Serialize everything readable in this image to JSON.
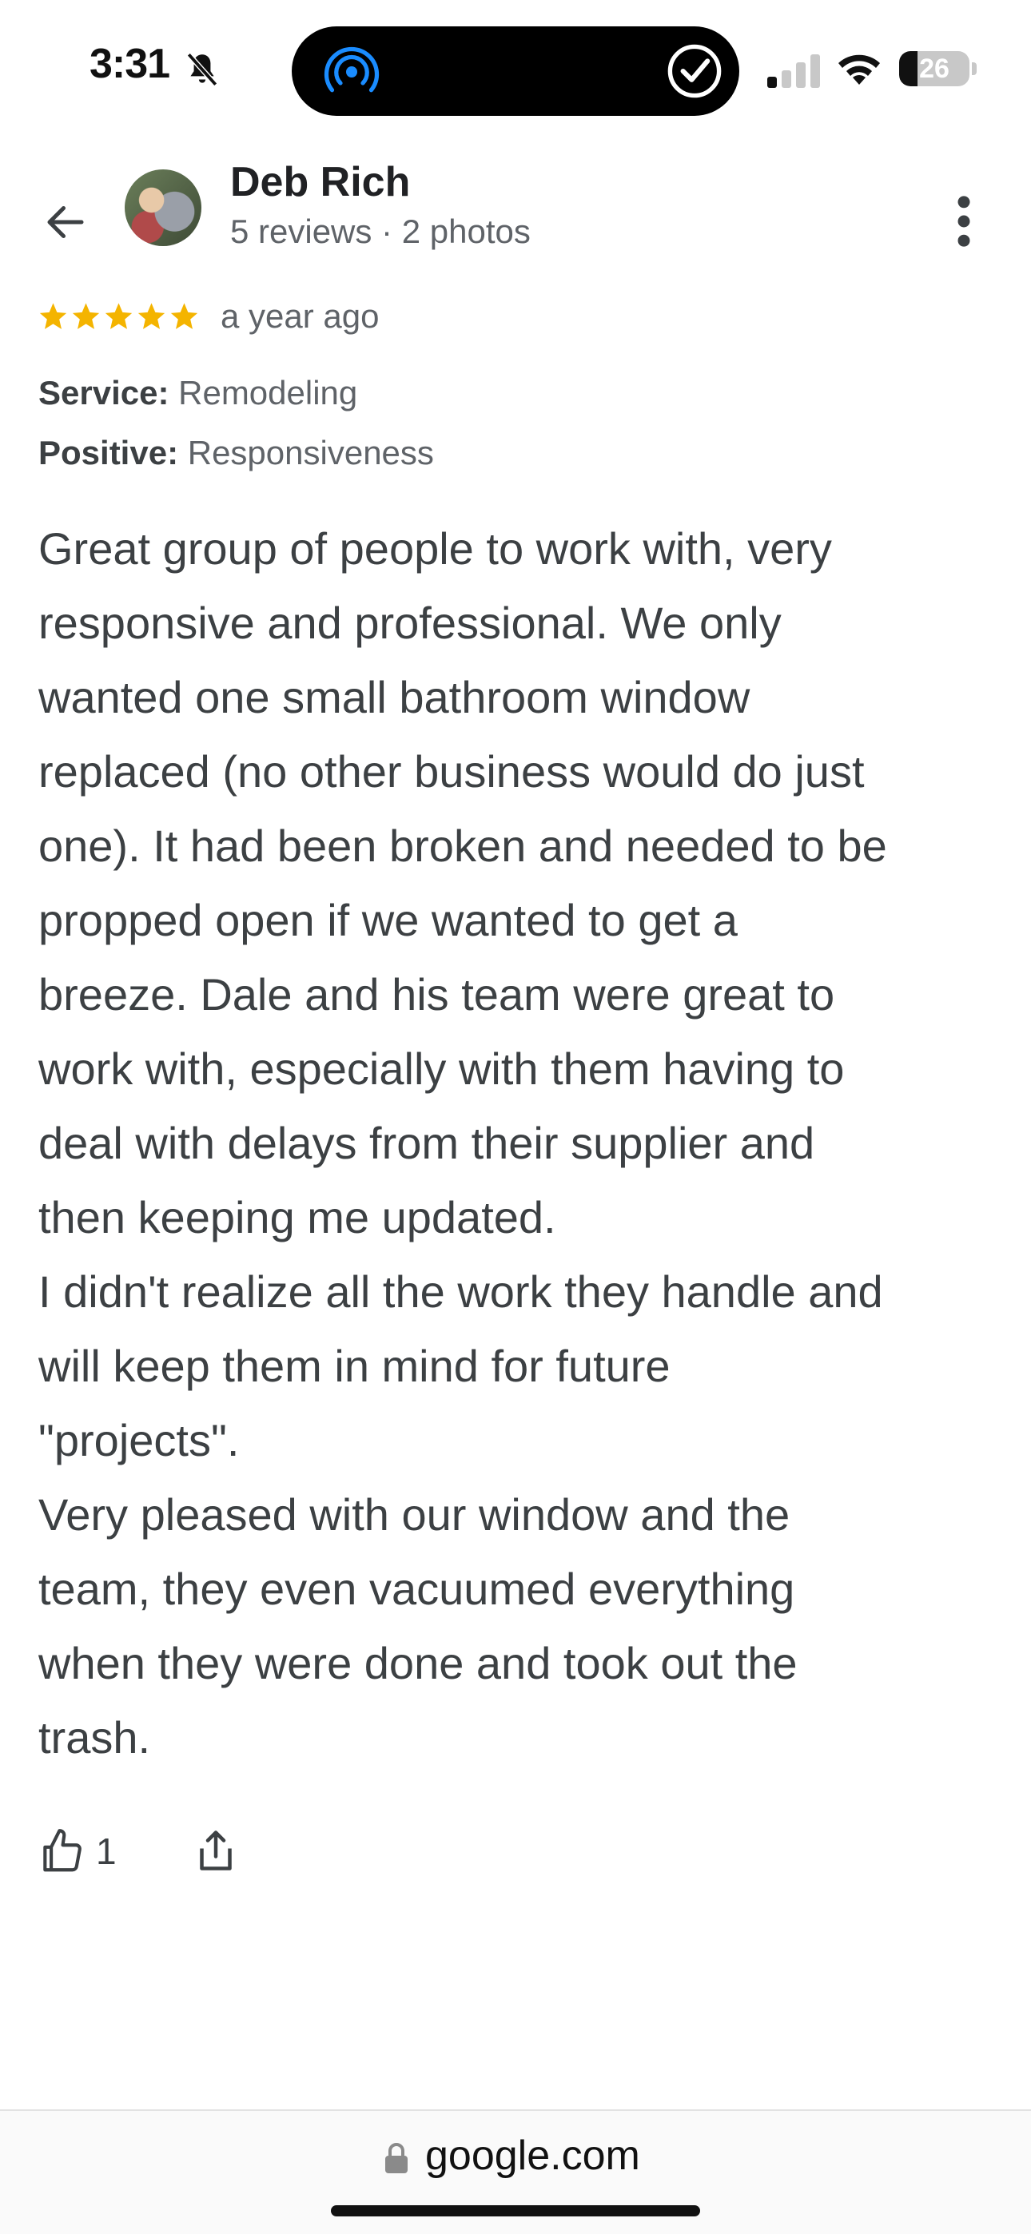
{
  "status_bar": {
    "time": "3:31",
    "battery": "26",
    "battery_level": 0.26
  },
  "header": {
    "name": "Deb Rich",
    "meta": "5 reviews · 2 photos"
  },
  "review": {
    "rating": 5,
    "max_rating": 5,
    "time": "a year ago",
    "service_label": "Service:",
    "service_value": "Remodeling",
    "positive_label": "Positive:",
    "positive_value": "Responsiveness",
    "text": "Great group of people to work with, very\nresponsive and professional. We only\nwanted one small bathroom window\nreplaced (no other business would do just\none). It had been broken and needed to be\npropped open if we wanted to get a\nbreeze. Dale and his team were great to\nwork with, especially with them having to\ndeal with delays from their supplier and\nthen keeping me updated.\nI didn't realize all the work they handle and\nwill keep them in mind for future\n\"projects\".\nVery pleased with our window and the\nteam, they even vacuumed everything\nwhen they were done and took out the\ntrash."
  },
  "actions": {
    "like_count": "1"
  },
  "browser": {
    "url": "google.com"
  },
  "colors": {
    "star": "#f4b400",
    "text": "#3c4043",
    "muted": "#5f6368",
    "airdrop": "#1a8cff"
  },
  "icons": [
    "bell-slash-icon",
    "airdrop-icon",
    "check-circle-icon",
    "signal-icon",
    "wifi-icon",
    "back-arrow-icon",
    "more-vert-icon",
    "star-icon",
    "thumb-up-icon",
    "share-icon",
    "lock-icon"
  ]
}
